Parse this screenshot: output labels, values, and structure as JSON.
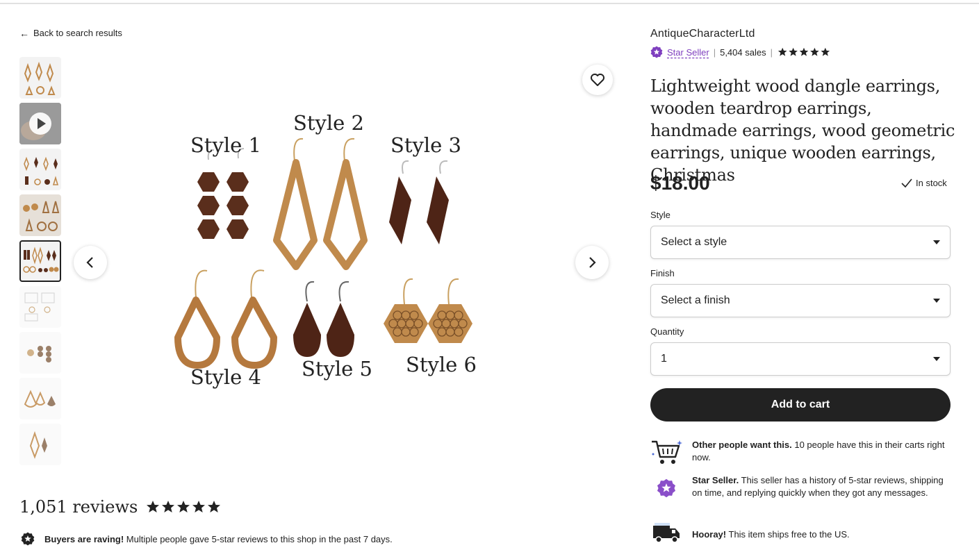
{
  "nav": {
    "back_label": "Back to search results"
  },
  "gallery": {
    "style_labels": [
      "Style 1",
      "Style 2",
      "Style 3",
      "Style 4",
      "Style 5",
      "Style 6"
    ]
  },
  "reviews": {
    "title": "1,051 reviews",
    "rating": 5,
    "raving_bold": "Buyers are raving!",
    "raving_text": " Multiple people gave 5-star reviews to this shop in the past 7 days."
  },
  "shop": {
    "name": "AntiqueCharacterLtd",
    "badge": "Star Seller",
    "sales": "5,404 sales",
    "rating": 5
  },
  "listing": {
    "title": "Lightweight wood dangle earrings, wooden teardrop earrings, handmade earrings, wood geometric earrings, unique wooden earrings, Christmas",
    "price": "$18.00",
    "stock": "In stock"
  },
  "options": {
    "style_label": "Style",
    "style_value": "Select a style",
    "finish_label": "Finish",
    "finish_value": "Select a finish",
    "quantity_label": "Quantity",
    "quantity_value": "1"
  },
  "cart": {
    "add_label": "Add to cart"
  },
  "highlights": {
    "demand_bold": "Other people want this.",
    "demand_text": " 10 people have this in their carts right now.",
    "seller_bold": "Star Seller.",
    "seller_text": " This seller has a history of 5-star reviews, shipping on time, and replying quickly when they got any messages.",
    "ship_bold": "Hooray!",
    "ship_text": " This item ships free to the US."
  },
  "colors": {
    "accent_purple": "#7f3fbf",
    "button_dark": "#222222",
    "walnut": "#5a2e1c",
    "light_wood": "#c08a4c"
  }
}
